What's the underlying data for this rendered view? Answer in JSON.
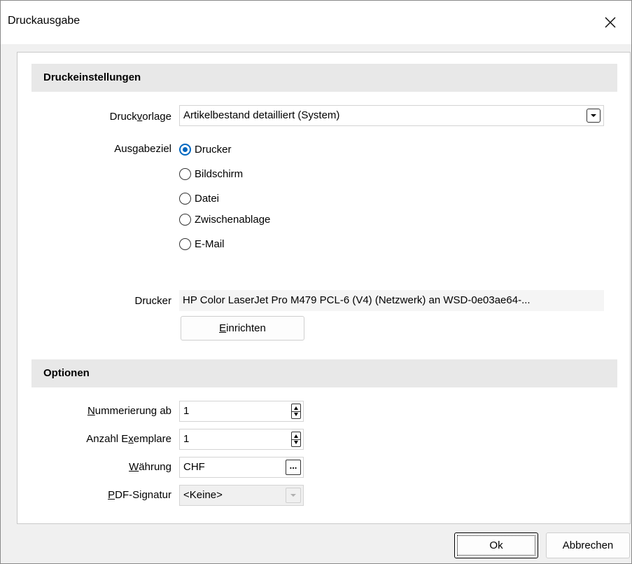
{
  "window": {
    "title": "Druckausgabe",
    "close_icon": "close-icon"
  },
  "print_settings": {
    "header": "Druckeinstellungen",
    "template": {
      "label_pre": "Druck",
      "label_u": "v",
      "label_post": "orlage",
      "value": "Artikelbestand detailliert (System)"
    },
    "output_target": {
      "label": "Ausgabeziel",
      "options": [
        {
          "label": "Drucker",
          "selected": true
        },
        {
          "label": "Bildschirm",
          "selected": false
        },
        {
          "label": "Datei",
          "selected": false
        },
        {
          "label": "Zwischenablage",
          "selected": false
        },
        {
          "label": "E-Mail",
          "selected": false
        }
      ]
    },
    "printer": {
      "label": "Drucker",
      "value": "HP Color LaserJet Pro M479 PCL-6 (V4) (Netzwerk) an WSD-0e03ae64-..."
    },
    "setup_button": {
      "u": "E",
      "rest": "inrichten"
    }
  },
  "options": {
    "header": "Optionen",
    "numbering": {
      "label_u": "N",
      "label_rest": "ummerierung ab",
      "value": "1"
    },
    "copies": {
      "label_pre": "Anzahl E",
      "label_u": "x",
      "label_post": "emplare",
      "value": "1"
    },
    "currency": {
      "label_u": "W",
      "label_rest": "ährung",
      "value": "CHF",
      "button": "..."
    },
    "pdf_signature": {
      "label_u": "P",
      "label_rest": "DF-Signatur",
      "value": "<Keine>"
    }
  },
  "buttons": {
    "ok": "Ok",
    "cancel": "Abbrechen"
  },
  "colors": {
    "accent": "#0067c0",
    "section_bg": "#e8e8e8",
    "window_bg": "#f0f0f0"
  }
}
